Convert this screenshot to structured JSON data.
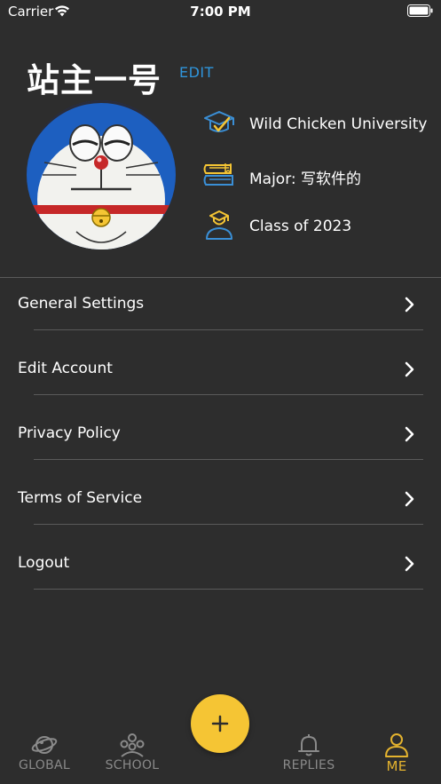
{
  "status_bar": {
    "carrier": "Carrier",
    "time": "7:00 PM"
  },
  "profile": {
    "username": "站主一号",
    "edit_label": "EDIT",
    "university": "Wild Chicken University",
    "major": "Major: 写软件的",
    "class_year": "Class of 2023"
  },
  "menu": {
    "items": [
      {
        "label": "General Settings"
      },
      {
        "label": "Edit Account"
      },
      {
        "label": "Privacy Policy"
      },
      {
        "label": "Terms of Service"
      },
      {
        "label": "Logout"
      }
    ]
  },
  "fab": {
    "label": "+"
  },
  "tab_bar": {
    "tabs": [
      {
        "label": "GLOBAL",
        "icon": "planet-icon",
        "active": false
      },
      {
        "label": "SCHOOL",
        "icon": "group-icon",
        "active": false
      },
      {
        "label": "REPLIES",
        "icon": "bell-icon",
        "active": false
      },
      {
        "label": "ME",
        "icon": "person-icon",
        "active": true
      }
    ]
  },
  "colors": {
    "background": "#2d2d2d",
    "accent_yellow": "#f5c534",
    "active_tab": "#e4b32e",
    "link_blue": "#2f95dc",
    "icon_blue": "#3a8fd6",
    "inactive_tab": "#8a8a8a",
    "divider": "#5a5a5a"
  }
}
